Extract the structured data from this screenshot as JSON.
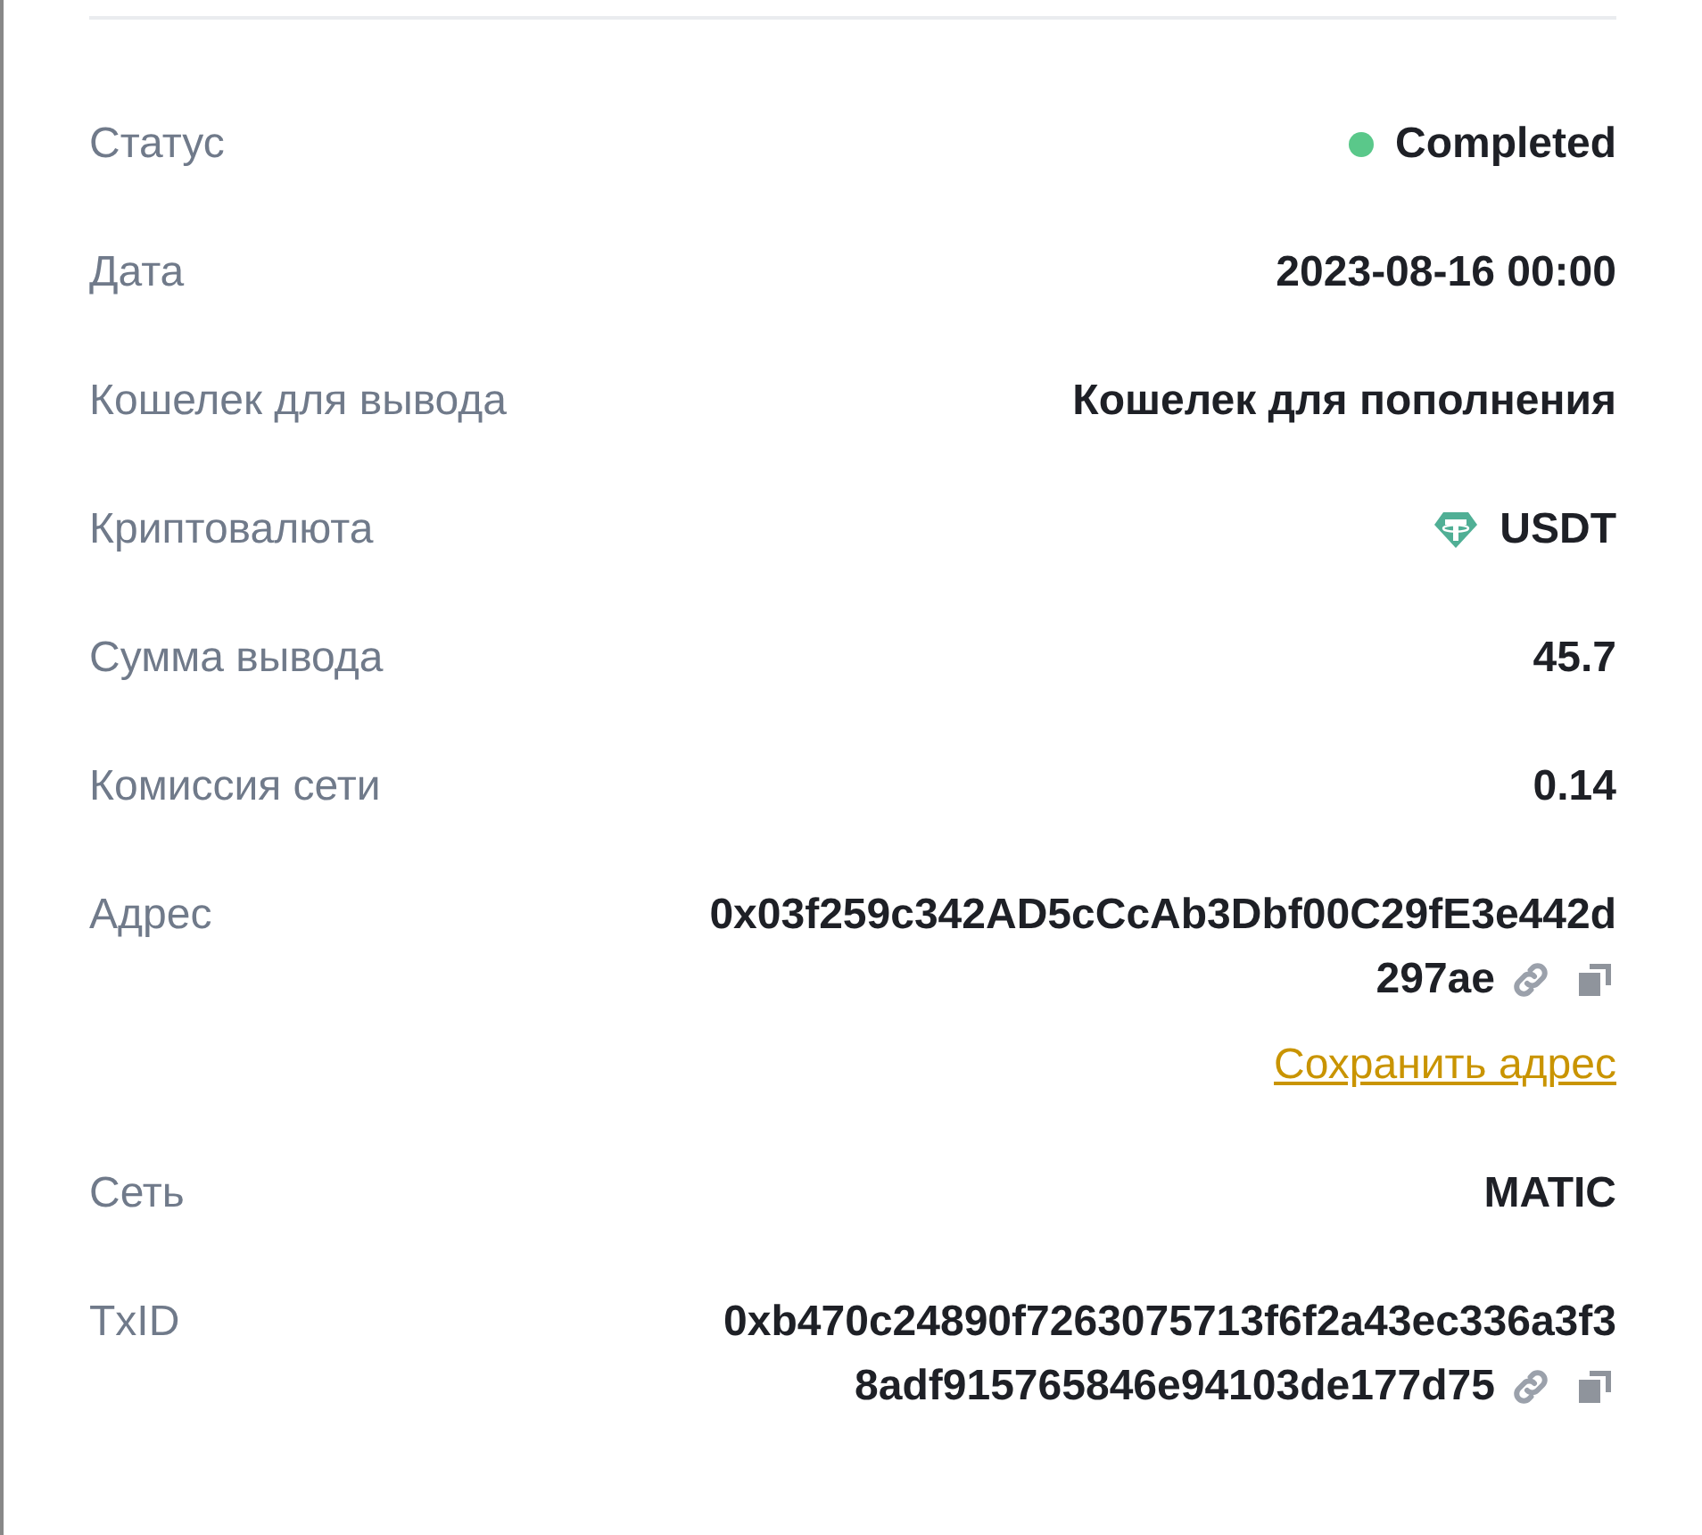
{
  "rows": [
    {
      "kind": "status",
      "label": "Статус",
      "value": "Completed",
      "color": "#5ac88a"
    },
    {
      "kind": "text",
      "label": "Дата",
      "value": "2023-08-16 00:00"
    },
    {
      "kind": "text",
      "label": "Кошелек для вывода",
      "value": "Кошелек для пополнения"
    },
    {
      "kind": "crypto",
      "label": "Криптовалюта",
      "value": "USDT"
    },
    {
      "kind": "text",
      "label": "Сумма вывода",
      "value": "45.7"
    },
    {
      "kind": "text",
      "label": "Комиссия сети",
      "value": "0.14"
    },
    {
      "kind": "hash",
      "label": "Адрес",
      "lines": [
        "0x03f259c342AD5cCcAb3Dbf00C29fE3e442d",
        "297ae"
      ],
      "link": "Сохранить адрес"
    },
    {
      "kind": "text",
      "label": "Сеть",
      "value": "MATIC"
    },
    {
      "kind": "hash",
      "label": "TxID",
      "lines": [
        "0xb470c24890f7263075713f6f2a43ec336a3f3",
        "8adf915765846e94103de177d75"
      ]
    }
  ]
}
